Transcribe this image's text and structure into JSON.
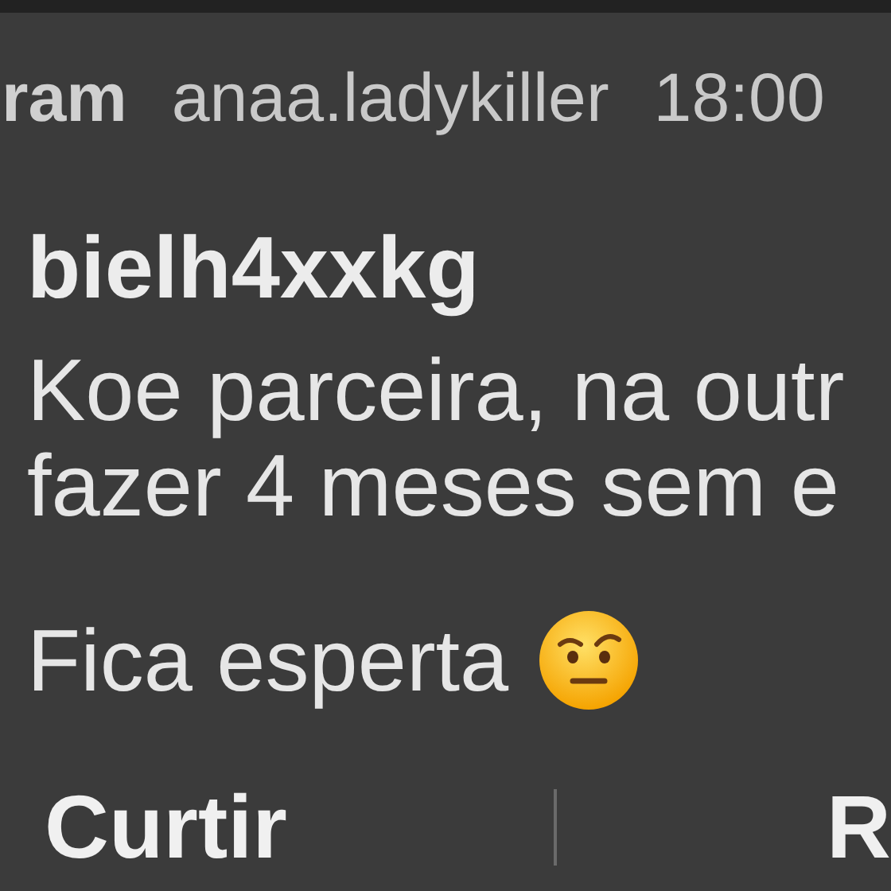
{
  "header": {
    "app": "ram",
    "account": "anaa.ladykiller",
    "time": "18:00"
  },
  "message": {
    "sender": "bielh4xxkg",
    "lines": [
      "Koe parceira, na outr",
      "fazer 4 meses sem e",
      "Fica esperta"
    ]
  },
  "actions": [
    "Curtir",
    "R"
  ]
}
